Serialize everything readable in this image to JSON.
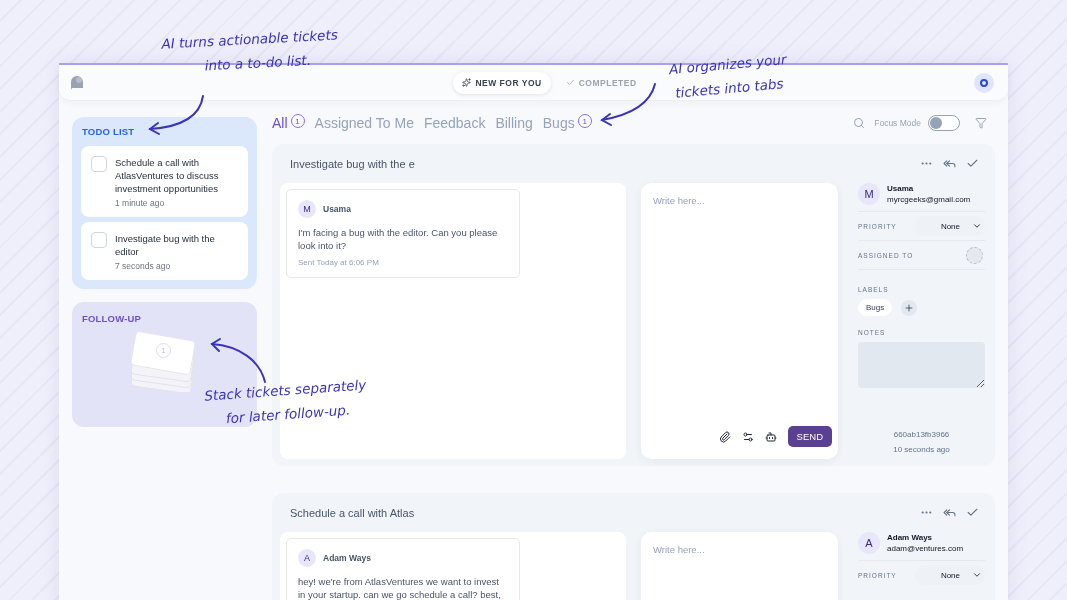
{
  "annotations": [
    {
      "lines": [
        "AI turns actionable tickets",
        "into a to-do list."
      ]
    },
    {
      "lines": [
        "AI organizes your",
        "tickets into tabs"
      ]
    },
    {
      "lines": [
        "Stack tickets separately",
        "for later follow-up."
      ]
    }
  ],
  "topbar": {
    "views": [
      {
        "label": "NEW FOR YOU",
        "selected": true
      },
      {
        "label": "COMPLETED",
        "selected": false
      }
    ]
  },
  "sidebar": {
    "todo": {
      "title": "TODO LIST",
      "items": [
        {
          "text": "Schedule a call with AtlasVentures to discuss investment opportunities",
          "time": "1 minute ago",
          "checked": false
        },
        {
          "text": "Investigate bug with the editor",
          "time": "7 seconds ago",
          "checked": false
        }
      ]
    },
    "follow_up": {
      "title": "FOLLOW-UP",
      "count": "1"
    }
  },
  "tabs": [
    {
      "label": "All",
      "count": "1",
      "selected": true
    },
    {
      "label": "Assigned To Me",
      "selected": false
    },
    {
      "label": "Feedback",
      "selected": false
    },
    {
      "label": "Billing",
      "selected": false
    },
    {
      "label": "Bugs",
      "count": "1",
      "selected": false
    }
  ],
  "toolbar": {
    "focus_mode": {
      "label": "Focus Mode",
      "on": false
    }
  },
  "tickets": [
    {
      "subject": "Investigate bug with the e",
      "message": {
        "initial": "M",
        "author": "Usama",
        "body": "I'm facing a bug with the editor. Can you please look into it?",
        "sent": "Sent Today at 6:06 PM"
      },
      "compose": {
        "placeholder": "Write here...",
        "send": "SEND"
      },
      "contact": {
        "initial": "M",
        "name": "Usama",
        "email": "myrcgeeks@gmail.com"
      },
      "priority": {
        "label": "PRIORITY",
        "value": "None"
      },
      "assigned_to": {
        "label": "ASSIGNED TO"
      },
      "labels": {
        "label": "LABELS",
        "items": [
          "Bugs"
        ]
      },
      "notes": {
        "label": "NOTES"
      },
      "id": "660ab13fb3966",
      "time": "10 seconds ago"
    },
    {
      "subject": "Schedule a call with Atlas",
      "message": {
        "initial": "A",
        "author": "Adam Ways",
        "body": "hey! we're from AtlasVentures we want to invest in your startup. can we go schedule a call? best,"
      },
      "compose": {
        "placeholder": "Write here..."
      },
      "contact": {
        "initial": "A",
        "name": "Adam Ways",
        "email": "adam@ventures.com"
      },
      "priority": {
        "label": "PRIORITY",
        "value": "None"
      }
    }
  ]
}
